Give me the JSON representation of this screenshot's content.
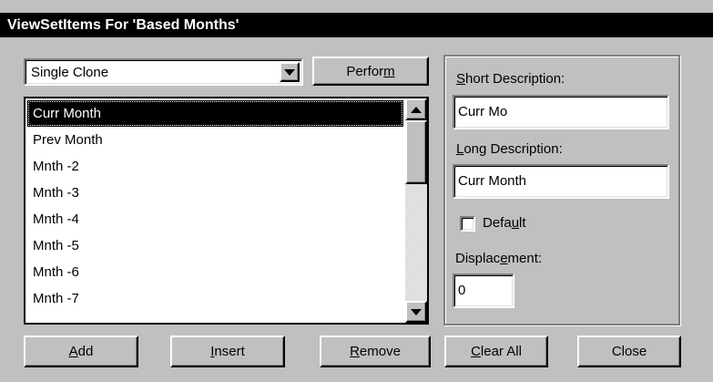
{
  "window": {
    "title": "ViewSetItems For 'Based Months'"
  },
  "combo": {
    "selected": "Single Clone"
  },
  "perform_button": {
    "pre": "Perfor",
    "u": "m",
    "post": ""
  },
  "list": {
    "items": [
      "Curr Month",
      "Prev Month",
      "Mnth -2",
      "Mnth -3",
      "Mnth -4",
      "Mnth -5",
      "Mnth -6",
      "Mnth -7"
    ],
    "selected_index": 0
  },
  "short_desc": {
    "label_u": "S",
    "label_rest": "hort Description:",
    "value": "Curr Mo"
  },
  "long_desc": {
    "label_u": "L",
    "label_rest": "ong Description:",
    "value": "Curr Month"
  },
  "default_check": {
    "label_pre": "Defa",
    "label_u": "u",
    "label_post": "lt",
    "checked": false
  },
  "displacement": {
    "label_pre": "Displac",
    "label_u": "e",
    "label_post": "ment:",
    "value": "0"
  },
  "buttons": {
    "add": {
      "u": "A",
      "rest": "dd"
    },
    "insert": {
      "u": "I",
      "rest": "nsert"
    },
    "remove": {
      "u": "R",
      "rest": "emove"
    },
    "clear_all": {
      "u": "C",
      "rest": "lear All"
    },
    "close": {
      "label": "Close"
    }
  }
}
